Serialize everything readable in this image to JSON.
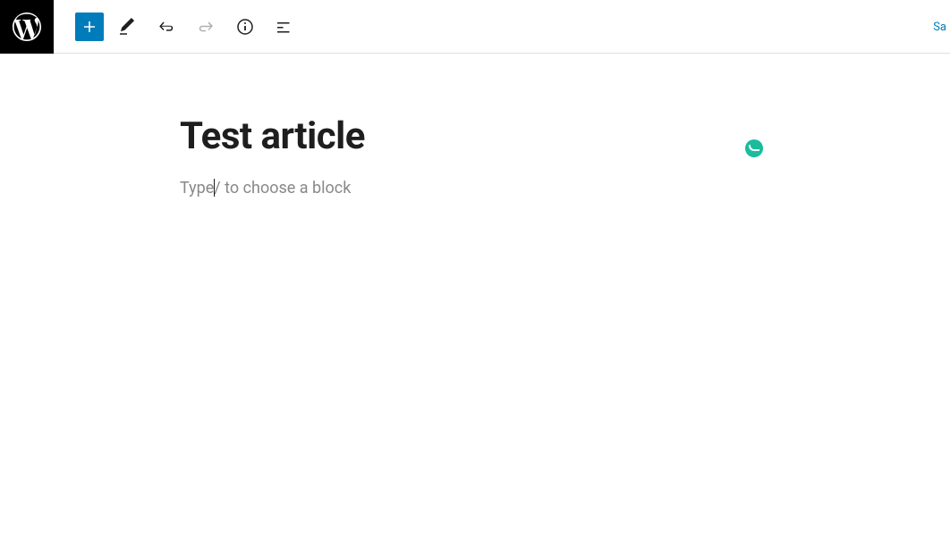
{
  "header": {
    "save_label": "Sa"
  },
  "toolbar": {
    "add_label": "Add block",
    "tools_label": "Tools",
    "undo_label": "Undo",
    "redo_label": "Redo",
    "info_label": "Details",
    "outline_label": "Document Overview"
  },
  "editor": {
    "post_title": "Test article",
    "placeholder_before": "Type",
    "placeholder_after": "/ to choose a block"
  },
  "badge": {
    "name": "readability-ok"
  },
  "colors": {
    "primary": "#007cba",
    "badge": "#1abc9c"
  }
}
